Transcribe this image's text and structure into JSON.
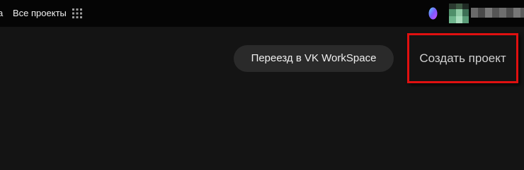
{
  "topbar": {
    "cut_text": "а",
    "all_projects_label": "Все проекты",
    "apps_icon": "grid-icon",
    "assistant_icon": "ai-assistant-icon",
    "avatar_icon": "user-avatar"
  },
  "main": {
    "migrate_label": "Переезд в VK WorkSpace",
    "create_project_label": "Создать проект"
  },
  "colors": {
    "page_bg": "#141414",
    "topbar_bg": "#050505",
    "migrate_bg": "#2a2a2a",
    "highlight_border": "#e01010"
  }
}
